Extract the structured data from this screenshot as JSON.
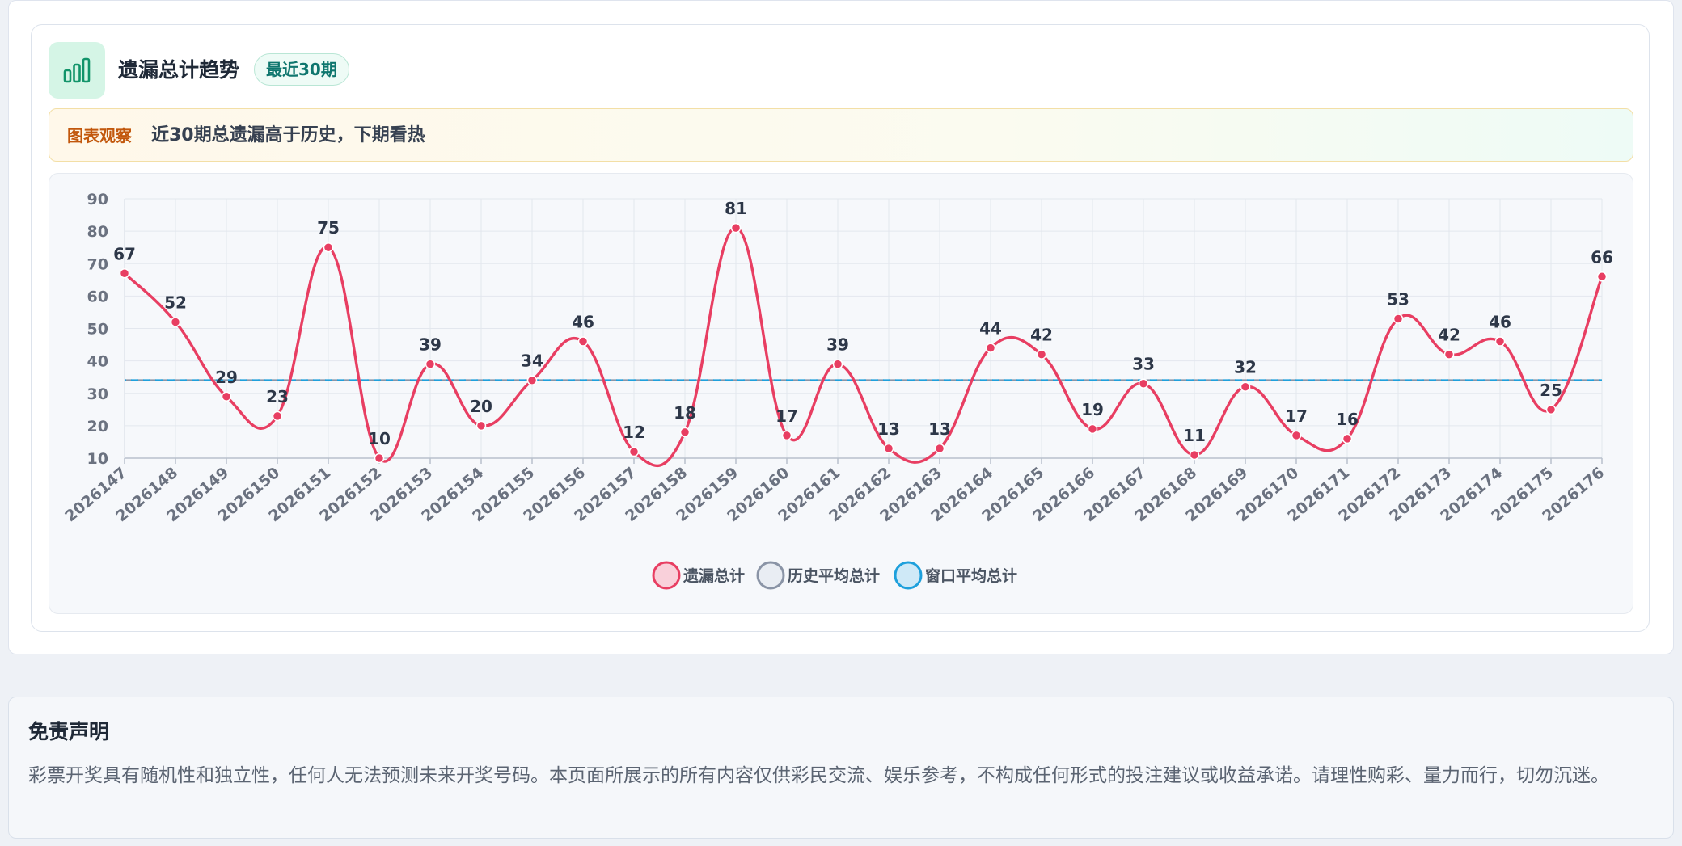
{
  "card": {
    "title": "遗漏总计趋势",
    "badge": "最近30期",
    "icon": "bar-chart-icon",
    "observe_tag": "图表观察",
    "observe_text": "近30期总遗漏高于历史，下期看热"
  },
  "chart_data": {
    "type": "line",
    "title": "",
    "xlabel": "",
    "ylabel": "",
    "ylim": [
      10,
      90
    ],
    "yticks": [
      10,
      20,
      30,
      40,
      50,
      60,
      70,
      80,
      90
    ],
    "grid": true,
    "legend_position": "bottom-center",
    "categories": [
      "2026147",
      "2026148",
      "2026149",
      "2026150",
      "2026151",
      "2026152",
      "2026153",
      "2026154",
      "2026155",
      "2026156",
      "2026157",
      "2026158",
      "2026159",
      "2026160",
      "2026161",
      "2026162",
      "2026163",
      "2026164",
      "2026165",
      "2026166",
      "2026167",
      "2026168",
      "2026169",
      "2026170",
      "2026171",
      "2026172",
      "2026173",
      "2026174",
      "2026175",
      "2026176"
    ],
    "series": [
      {
        "name": "遗漏总计",
        "color": "#e83e62",
        "style": "solid",
        "show_labels": true,
        "values": [
          67,
          52,
          29,
          23,
          75,
          10,
          39,
          20,
          34,
          46,
          12,
          18,
          81,
          17,
          39,
          13,
          13,
          44,
          42,
          19,
          33,
          11,
          32,
          17,
          16,
          53,
          42,
          46,
          25,
          66
        ]
      },
      {
        "name": "历史平均总计",
        "color": "#8a94a6",
        "style": "dashed",
        "values": [
          34,
          34,
          34,
          34,
          34,
          34,
          34,
          34,
          34,
          34,
          34,
          34,
          34,
          34,
          34,
          34,
          34,
          34,
          34,
          34,
          34,
          34,
          34,
          34,
          34,
          34,
          34,
          34,
          34,
          34
        ]
      },
      {
        "name": "窗口平均总计",
        "color": "#1ea0dc",
        "style": "dashed",
        "values": [
          34,
          34,
          34,
          34,
          34,
          34,
          34,
          34,
          34,
          34,
          34,
          34,
          34,
          34,
          34,
          34,
          34,
          34,
          34,
          34,
          34,
          34,
          34,
          34,
          34,
          34,
          34,
          34,
          34,
          34
        ]
      }
    ],
    "colors": {
      "axis_text": "#6b7280",
      "grid": "#e3e7ee",
      "label_text": "#2d3748"
    }
  },
  "disclaimer": {
    "title": "免责声明",
    "text": "彩票开奖具有随机性和独立性，任何人无法预测未来开奖号码。本页面所展示的所有内容仅供彩民交流、娱乐参考，不构成任何形式的投注建议或收益承诺。请理性购彩、量力而行，切勿沉迷。"
  }
}
